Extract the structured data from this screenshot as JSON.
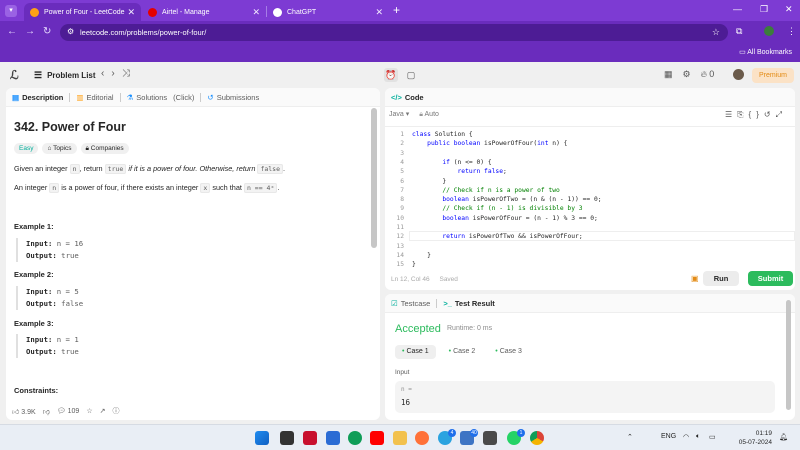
{
  "browser": {
    "tabs": [
      {
        "title": "Power of Four - LeetCode",
        "active": true,
        "favicon_color": "#ffa116"
      },
      {
        "title": "Airtel - Manage",
        "active": false,
        "favicon_color": "#e40000"
      },
      {
        "title": "ChatGPT",
        "active": false,
        "favicon_color": "#ffffff"
      }
    ],
    "url": "leetcode.com/problems/power-of-four/",
    "bookmarks_label": "All Bookmarks"
  },
  "topbar": {
    "problem_list": "Problem List",
    "streak_count": "0",
    "premium": "Premium"
  },
  "left_panel": {
    "tabs": [
      "Description",
      "Editorial",
      "Solutions",
      "(Click)",
      "Submissions"
    ],
    "title": "342. Power of Four",
    "chips": [
      "Easy",
      "Topics",
      "Companies"
    ],
    "desc1": {
      "a": "Given an integer ",
      "c1": "n",
      "b": ", return ",
      "c2": "true",
      "c": " if it is a power of four. Otherwise, return ",
      "c3": "false",
      "d": "."
    },
    "desc2": {
      "a": "An integer ",
      "c1": "n",
      "b": " is a power of four, if there exists an integer ",
      "c2": "x",
      "c": " such that ",
      "c3": "n == 4ˣ",
      "d": "."
    },
    "examples": [
      {
        "heading": "Example 1:",
        "input_label": "Input:",
        "input": "n = 16",
        "output_label": "Output:",
        "output": "true"
      },
      {
        "heading": "Example 2:",
        "input_label": "Input:",
        "input": "n = 5",
        "output_label": "Output:",
        "output": "false"
      },
      {
        "heading": "Example 3:",
        "input_label": "Input:",
        "input": "n = 1",
        "output_label": "Output:",
        "output": "true"
      }
    ],
    "constraints": "Constraints:",
    "footer": {
      "likes": "3.9K",
      "comments": "109"
    }
  },
  "code_panel": {
    "tab": "Code",
    "language": "Java",
    "mode": "Auto",
    "lines": [
      "class Solution {",
      "    public boolean isPowerOfFour(int n) {",
      "",
      "        if (n <= 0) {",
      "            return false;",
      "        }",
      "        // Check if n is a power of two",
      "        boolean isPowerOfTwo = (n & (n - 1)) == 0;",
      "        // Check if (n - 1) is divisible by 3",
      "        boolean isPowerOfFour = (n - 1) % 3 == 0;",
      "",
      "        return isPowerOfTwo && isPowerOfFour;",
      "",
      "    }",
      "}"
    ],
    "line_numbers": [
      "1",
      "2",
      "3",
      "4",
      "5",
      "6",
      "7",
      "8",
      "9",
      "10",
      "11",
      "12",
      "13",
      "14",
      "15"
    ],
    "status_pos": "Ln 12, Col 46",
    "status_saved": "Saved",
    "run": "Run",
    "submit": "Submit"
  },
  "result_panel": {
    "tabs": [
      "Testcase",
      "Test Result"
    ],
    "verdict": "Accepted",
    "runtime": "Runtime: 0 ms",
    "cases": [
      "Case 1",
      "Case 2",
      "Case 3"
    ],
    "input_label": "Input",
    "var": "n =",
    "value": "16"
  },
  "taskbar": {
    "lang": "ENG",
    "time": "01:19",
    "date": "05-07-2024",
    "badge_1": "4",
    "badge_2": "40",
    "badge_3": "1"
  }
}
